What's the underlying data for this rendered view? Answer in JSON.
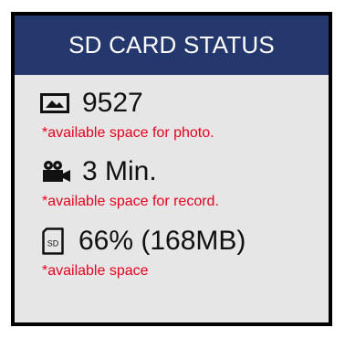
{
  "header": {
    "title": "SD CARD STATUS"
  },
  "photo": {
    "icon": "photo-icon",
    "value": "9527",
    "note": "*available space for photo."
  },
  "record": {
    "icon": "video-camera-icon",
    "value": "3 Min.",
    "note": "*available space for record."
  },
  "storage": {
    "icon": "sd-card-icon",
    "icon_text": "SD",
    "value": "66% (168MB)",
    "note": "*available space"
  },
  "colors": {
    "header_bg": "#24386e",
    "panel_bg": "#e6e6e6",
    "note_text": "#e6001e"
  }
}
